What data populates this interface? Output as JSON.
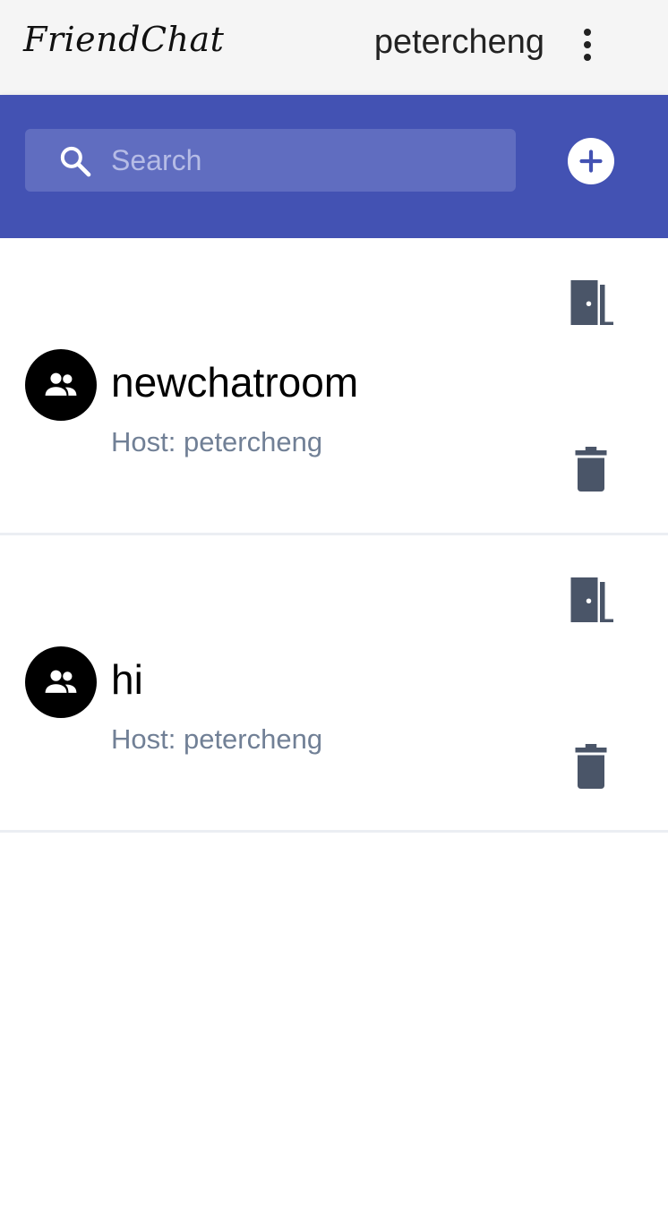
{
  "app": {
    "title": "FriendChat",
    "username": "petercheng"
  },
  "search": {
    "placeholder": "Search",
    "value": ""
  },
  "rooms": [
    {
      "name": "newchatroom",
      "host": "Host: petercheng"
    },
    {
      "name": "hi",
      "host": "Host: petercheng"
    }
  ],
  "colors": {
    "header_bg": "#f5f5f5",
    "accent": "#4352b3",
    "search_bg": "#606dc0",
    "icon_gray": "#4a5568",
    "host_text": "#718096"
  },
  "icons": {
    "menu": "more-vert-icon",
    "search": "search-icon",
    "add": "add-circle-icon",
    "room": "group-icon",
    "leave": "door-icon",
    "delete": "trash-icon"
  }
}
